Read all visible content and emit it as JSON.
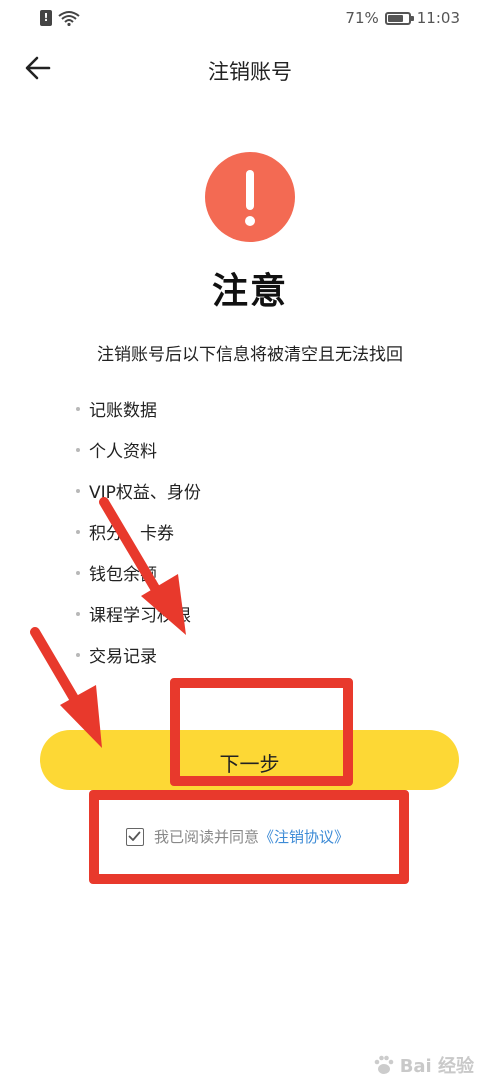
{
  "status_bar": {
    "battery": "71%",
    "time": "11:03",
    "icons": [
      "sim-alert-icon",
      "wifi-icon",
      "battery-icon"
    ]
  },
  "nav": {
    "title": "注销账号",
    "back_icon": "arrow-left-icon"
  },
  "warning": {
    "icon": "exclamation-icon",
    "color": "#f36a53",
    "heading": "注意",
    "description": "注销账号后以下信息将被清空且无法找回"
  },
  "info_items": [
    "记账数据",
    "个人资料",
    "VIP权益、身份",
    "积分、卡券",
    "钱包余额",
    "课程学习权限",
    "交易记录"
  ],
  "next_button": {
    "label": "下一步",
    "color": "#fdd835"
  },
  "agreement": {
    "checked": true,
    "text": "我已阅读并同意",
    "link": "《注销协议》",
    "link_color": "#3d8bd6"
  },
  "annotations": {
    "color": "#e8392c"
  },
  "watermark": {
    "text": "Bai 经验"
  }
}
